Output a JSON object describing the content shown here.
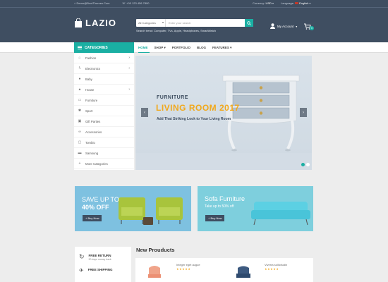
{
  "topbar": {
    "email": "Demo@BootThemes.Com",
    "phone": "+00 123 456 7890",
    "currency_label": "Currency:",
    "currency_value": "USD",
    "language_label": "Language:",
    "language_value": "English"
  },
  "header": {
    "logo": "LAZIO",
    "search_category": "All Categories",
    "search_placeholder": "Enter your search",
    "trend_text": "Search trend: Computer, TVs, Apple, Headphones, SmartWatch",
    "account_label": "My Account",
    "cart_count": "0"
  },
  "nav": {
    "categories_label": "CATEGORIES",
    "items": [
      {
        "label": "HOME"
      },
      {
        "label": "SHOP"
      },
      {
        "label": "PORTFOLIO"
      },
      {
        "label": "BLOG"
      },
      {
        "label": "FEATURES"
      }
    ]
  },
  "sidebar": {
    "items": [
      {
        "label": "Fashion",
        "icon": "hanger-icon"
      },
      {
        "label": "Electronics",
        "icon": "plug-icon"
      },
      {
        "label": "Baby",
        "icon": "baby-icon"
      },
      {
        "label": "House",
        "icon": "house-icon"
      },
      {
        "label": "Furniture",
        "icon": "sofa-icon"
      },
      {
        "label": "Sport",
        "icon": "sport-icon"
      },
      {
        "label": "Gift Parties",
        "icon": "gift-icon"
      },
      {
        "label": "Accessories",
        "icon": "glasses-icon"
      },
      {
        "label": "Tombio",
        "icon": "monitor-icon"
      },
      {
        "label": "Samsung",
        "icon": "tv-icon"
      },
      {
        "label": "More Categories",
        "icon": "plus-icon"
      }
    ]
  },
  "slider": {
    "subtitle": "FURNITURE",
    "title": "LIVING ROOM 2017",
    "description": "Add That Striking Look to Your Living Room"
  },
  "banners": [
    {
      "line1": "SAVE UP TO",
      "line2": "40% OFF",
      "button": "+ Buy Now"
    },
    {
      "line1": "Sofa Furniture",
      "line2": "Take up to 50% off",
      "button": "+ Buy Now"
    }
  ],
  "services": [
    {
      "title": "FREE RETURN",
      "subtitle": "30 days money back",
      "icon": "refresh-icon"
    },
    {
      "title": "FREE SHIPPING",
      "subtitle": "",
      "icon": "plane-icon"
    }
  ],
  "new_products": {
    "title": "New Prouducts",
    "items": [
      {
        "name": "Integer eget augue"
      },
      {
        "name": "Viverra sollicitudin"
      }
    ]
  },
  "colors": {
    "header": "#3f4e61",
    "accent": "#1aafa3",
    "highlight": "#f1a81c"
  }
}
